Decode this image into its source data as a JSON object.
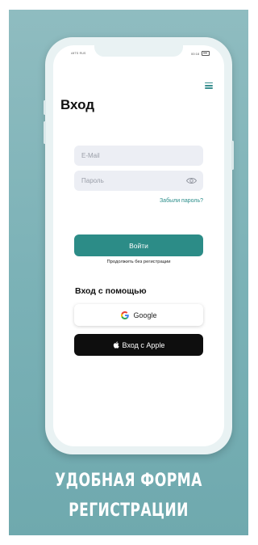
{
  "status_bar": {
    "carrier": "•MTS RUS",
    "time": "00:18"
  },
  "login": {
    "title": "Вход",
    "email_placeholder": "E-Mail",
    "password_placeholder": "Пароль",
    "forgot_password": "Забыли пароль?",
    "submit_label": "Войти",
    "continue_without_registration": "Продолжить без регистрации",
    "login_with_label": "Вход с помощью",
    "google_label": "Google",
    "apple_label": "Вход с Apple"
  },
  "caption": {
    "line1": "УДОБНАЯ ФОРМА",
    "line2": "РЕГИСТРАЦИИ"
  },
  "colors": {
    "background": "#7ab1b6",
    "accent": "#2c8c87",
    "apple_button": "#0e0e0e",
    "input_bg": "#eceef4"
  }
}
